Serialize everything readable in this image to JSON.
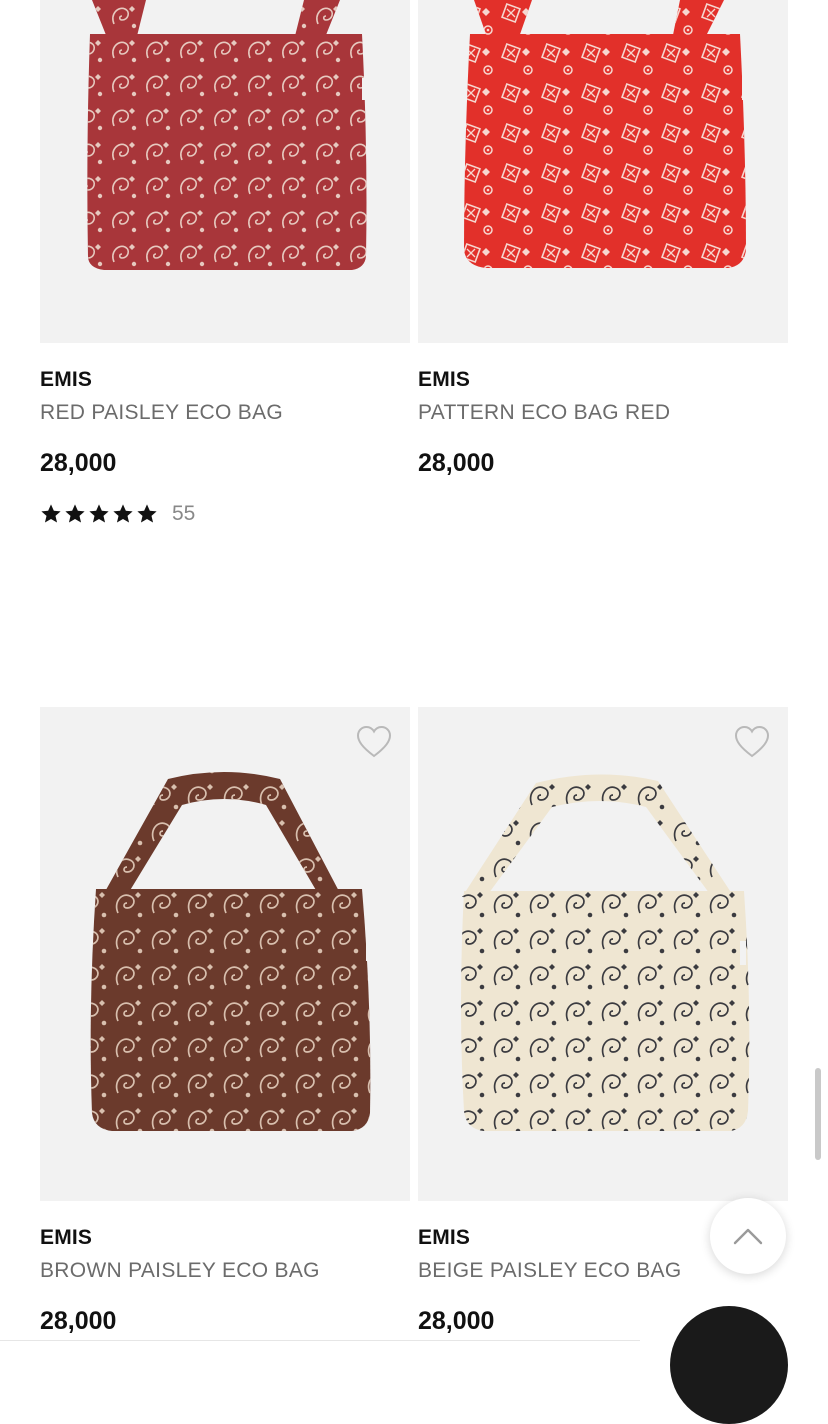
{
  "products": [
    {
      "brand": "EMIS",
      "name": "RED PAISLEY ECO BAG",
      "price": "28,000",
      "rating": {
        "stars": 5,
        "count": "55"
      },
      "bag_color": "#a8363a",
      "pattern_color": "#e6c9bf"
    },
    {
      "brand": "EMIS",
      "name": "PATTERN ECO BAG RED",
      "price": "28,000",
      "bag_color": "#e2302a",
      "pattern_color": "#f6d6cf"
    },
    {
      "brand": "EMIS",
      "name": "BROWN PAISLEY ECO BAG",
      "price": "28,000",
      "wishlist_icon": "heart-outline-icon",
      "bag_color": "#6b3a2c",
      "pattern_color": "#d8bfae"
    },
    {
      "brand": "EMIS",
      "name": "BEIGE PAISLEY ECO BAG",
      "price": "28,000",
      "wishlist_icon": "heart-outline-icon",
      "bag_color": "#efe6d2",
      "pattern_color": "#3b3b40"
    }
  ],
  "scroll_top_icon": "chevron-up-icon"
}
